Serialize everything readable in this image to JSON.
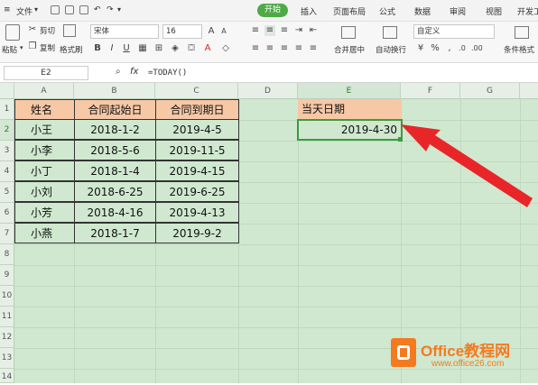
{
  "menubar": {
    "file": "文件",
    "tabs": [
      "开始",
      "插入",
      "页面布局",
      "公式",
      "数据",
      "审阅",
      "视图",
      "开发工"
    ]
  },
  "ribbon": {
    "paste": "粘贴",
    "cut": "剪切",
    "copy": "复制",
    "format_painter": "格式刷",
    "font_name": "宋体",
    "font_size": "16",
    "merge_center": "合并居中",
    "wrap_text": "自动换行",
    "number_format": "自定义",
    "conditional_format": "条件格式"
  },
  "formula_bar": {
    "name_box": "E2",
    "fx": "fx",
    "formula": "=TODAY()"
  },
  "columns": [
    "A",
    "B",
    "C",
    "D",
    "E",
    "F",
    "G"
  ],
  "rows": [
    "1",
    "2",
    "3",
    "4",
    "5",
    "6",
    "7",
    "8",
    "9",
    "10",
    "11",
    "12",
    "13",
    "14"
  ],
  "table": {
    "headers": [
      "姓名",
      "合同起始日",
      "合同到期日"
    ],
    "rows": [
      [
        "小王",
        "2018-1-2",
        "2019-4-5"
      ],
      [
        "小李",
        "2018-5-6",
        "2019-11-5"
      ],
      [
        "小丁",
        "2018-1-4",
        "2019-4-15"
      ],
      [
        "小刘",
        "2018-6-25",
        "2019-6-25"
      ],
      [
        "小芳",
        "2018-4-16",
        "2019-4-13"
      ],
      [
        "小燕",
        "2018-1-7",
        "2019-9-2"
      ]
    ]
  },
  "today": {
    "header": "当天日期",
    "value": "2019-4-30"
  },
  "watermark": {
    "brand": "Office教程网",
    "url": "www.office26.com"
  },
  "colors": {
    "sheet_bg": "#cfe8cf",
    "header_fill": "#f7c8a6",
    "active_tab": "#4eaa47",
    "arrow": "#e8262a",
    "logo": "#f47a20"
  }
}
